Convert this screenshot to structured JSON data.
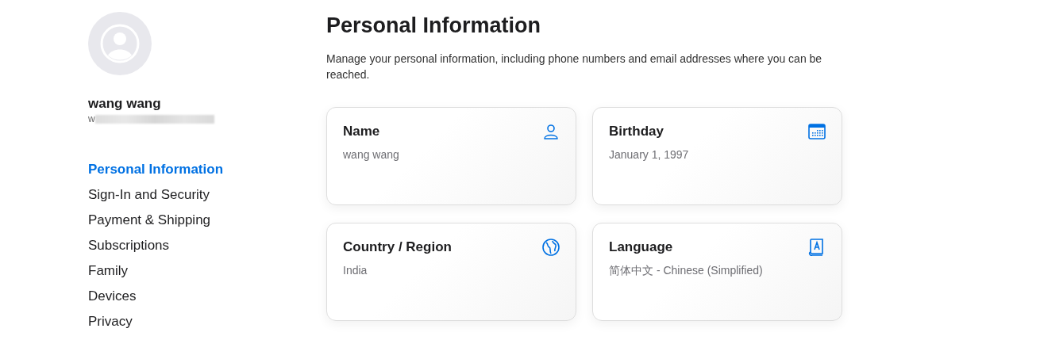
{
  "profile": {
    "name": "wang wang",
    "email": "w"
  },
  "nav": [
    {
      "label": "Personal Information",
      "selected": true
    },
    {
      "label": "Sign-In and Security",
      "selected": false
    },
    {
      "label": "Payment & Shipping",
      "selected": false
    },
    {
      "label": "Subscriptions",
      "selected": false
    },
    {
      "label": "Family",
      "selected": false
    },
    {
      "label": "Devices",
      "selected": false
    },
    {
      "label": "Privacy",
      "selected": false
    }
  ],
  "page": {
    "title": "Personal Information",
    "description": "Manage your personal information, including phone numbers and email addresses where you can be reached."
  },
  "cards": [
    {
      "title": "Name",
      "value": "wang wang"
    },
    {
      "title": "Birthday",
      "value": "January 1, 1997"
    },
    {
      "title": "Country / Region",
      "value": "India"
    },
    {
      "title": "Language",
      "value": "简体中文 - Chinese (Simplified)"
    }
  ]
}
